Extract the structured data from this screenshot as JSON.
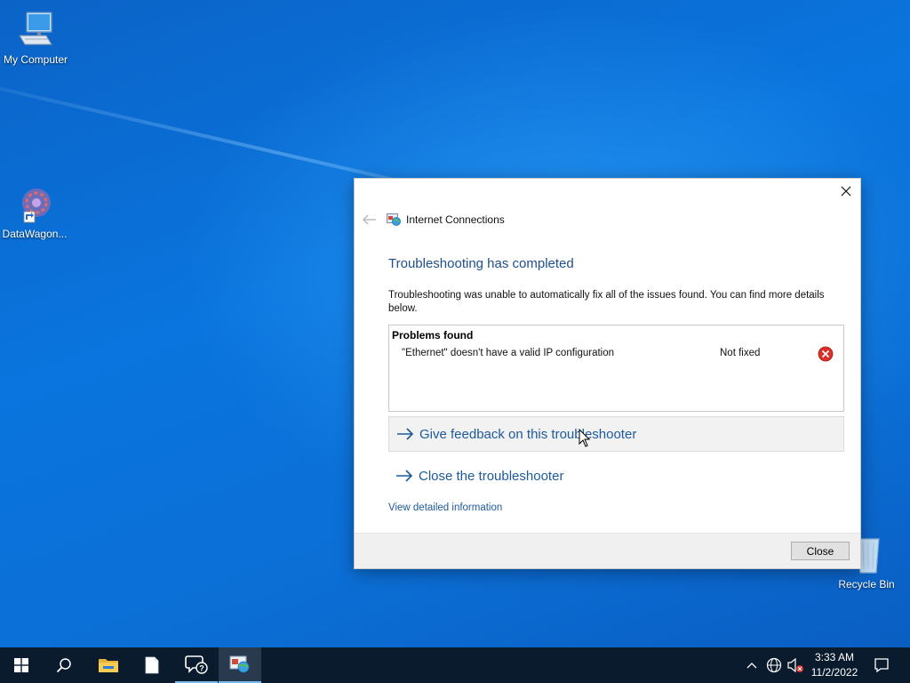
{
  "desktop": {
    "icons": [
      {
        "label": "My Computer",
        "icon": "computer-icon"
      },
      {
        "label": "DataWagon...",
        "icon": "datawagon-shortcut-icon"
      },
      {
        "label": "Recycle Bin",
        "icon": "recycle-bin-icon"
      }
    ]
  },
  "dialog": {
    "app_title": "Internet Connections",
    "heading": "Troubleshooting has completed",
    "description": "Troubleshooting was unable to automatically fix all of the issues found. You can find more details below.",
    "problems": {
      "title": "Problems found",
      "items": [
        {
          "description": "\"Ethernet\" doesn't have a valid IP configuration",
          "status": "Not fixed",
          "status_icon": "error-icon"
        }
      ]
    },
    "links": {
      "feedback": "Give feedback on this troubleshooter",
      "close_troubleshooter": "Close the troubleshooter",
      "details": "View detailed information"
    },
    "close_button": "Close"
  },
  "taskbar": {
    "items": [
      "start-icon",
      "search-icon",
      "file-explorer-icon",
      "notepad-icon",
      "help-chat-icon",
      "troubleshooter-app-icon"
    ],
    "clock": {
      "time": "3:33 AM",
      "date": "11/2/2022"
    }
  },
  "colors": {
    "accent_link": "#1c5a9c",
    "heading": "#1c4f8c",
    "taskbar": "#0b1b2e",
    "error": "#d9302c"
  }
}
